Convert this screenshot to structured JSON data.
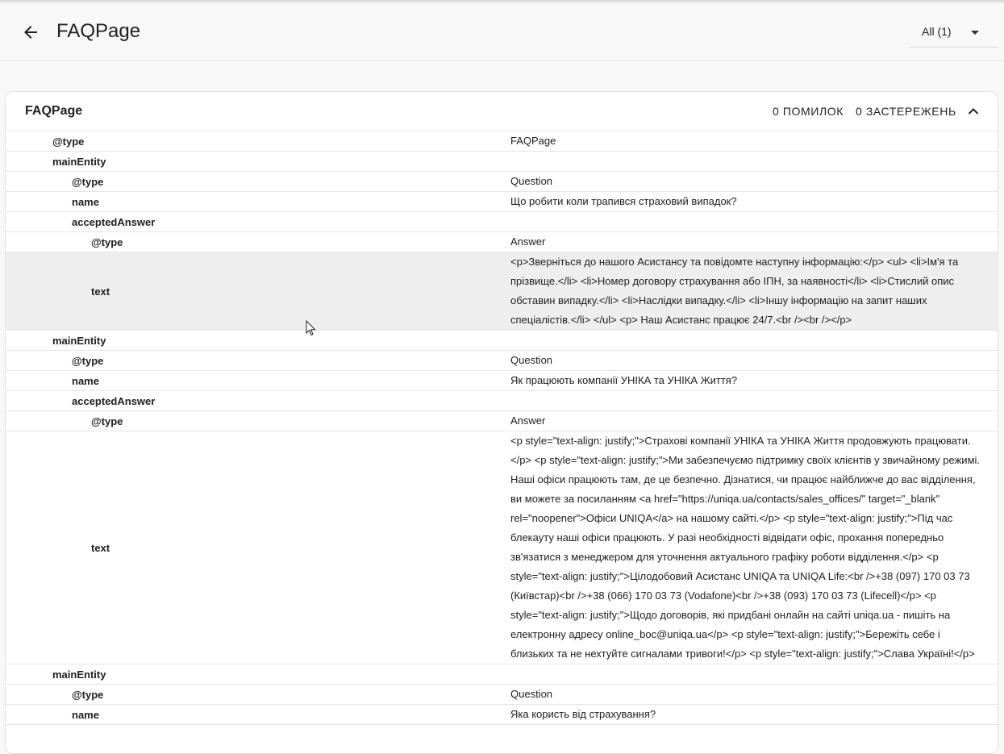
{
  "header": {
    "title": "FAQPage",
    "filter_label": "All (1)"
  },
  "card": {
    "title": "FAQPage",
    "errors": "0 ПОМИЛОК",
    "warnings": "0 ЗАСТЕРЕЖЕНЬ"
  },
  "rows": [
    {
      "key": "@type",
      "value": "FAQPage"
    },
    {
      "key": "mainEntity",
      "value": ""
    },
    {
      "key": "@type",
      "value": "Question"
    },
    {
      "key": "name",
      "value": "Що робити коли трапився страховий випадок?"
    },
    {
      "key": "acceptedAnswer",
      "value": ""
    },
    {
      "key": "@type",
      "value": "Answer"
    },
    {
      "key": "text",
      "value": "<p>Зверніться до нашого Асистансу та повідомте наступну інформацію:</p> <ul> <li>Ім'я та прізвище.</li> <li>Номер договору страхування або ІПН, за наявності</li> <li>Стислий опис обставин випадку.</li> <li>Наслідки випадку.</li> <li>Іншу інформацію на запит наших спеціалістів.</li> </ul> <p> Наш Асистанс працює 24/7.<br /><br /></p>"
    },
    {
      "key": "mainEntity",
      "value": ""
    },
    {
      "key": "@type",
      "value": "Question"
    },
    {
      "key": "name",
      "value": "Як працюють компанії УНІКА та УНІКА Життя?"
    },
    {
      "key": "acceptedAnswer",
      "value": ""
    },
    {
      "key": "@type",
      "value": "Answer"
    },
    {
      "key": "text",
      "value": "<p style=\"text-align: justify;\">Страхові компанії УНІКА та УНІКА Життя продовжують працювати.</p> <p style=\"text-align: justify;\">Ми забезпечуємо підтримку своїх клієнтів у звичайному режимі. Наші офіси працюють там, де це безпечно. Дізнатися, чи працює найближче до вас відділення, ви можете за посиланням <a href=\"https://uniqa.ua/contacts/sales_offices/\" target=\"_blank\" rel=\"noopener\">Офіси UNIQA</a> на нашому сайті.</p> <p style=\"text-align: justify;\">Під час блекауту наші офіси працюють. У разі необхідності відвідати офіс, прохання попередньо зв'язатися з менеджером для уточнення актуального графіку роботи відділення.</p> <p style=\"text-align: justify;\">Цілодобовий Асистанс UNIQA та UNIQA Life:<br />+38 (097) 170 03 73 (Київстар)<br />+38 (066) 170 03 73 (Vodafone)<br />+38 (093) 170 03 73 (Lifecell)</p> <p style=\"text-align: justify;\">Щодо договорів, які придбані онлайн на сайті uniqa.ua - пишіть на електронну адресу online_boc@uniqa.ua</p> <p style=\"text-align: justify;\">Бережіть себе і близьких та не нехтуйте сигналами тривоги!</p> <p style=\"text-align: justify;\">Слава Україні!</p>"
    },
    {
      "key": "mainEntity",
      "value": ""
    },
    {
      "key": "@type",
      "value": "Question"
    },
    {
      "key": "name",
      "value": "Яка користь від страхування?"
    }
  ]
}
